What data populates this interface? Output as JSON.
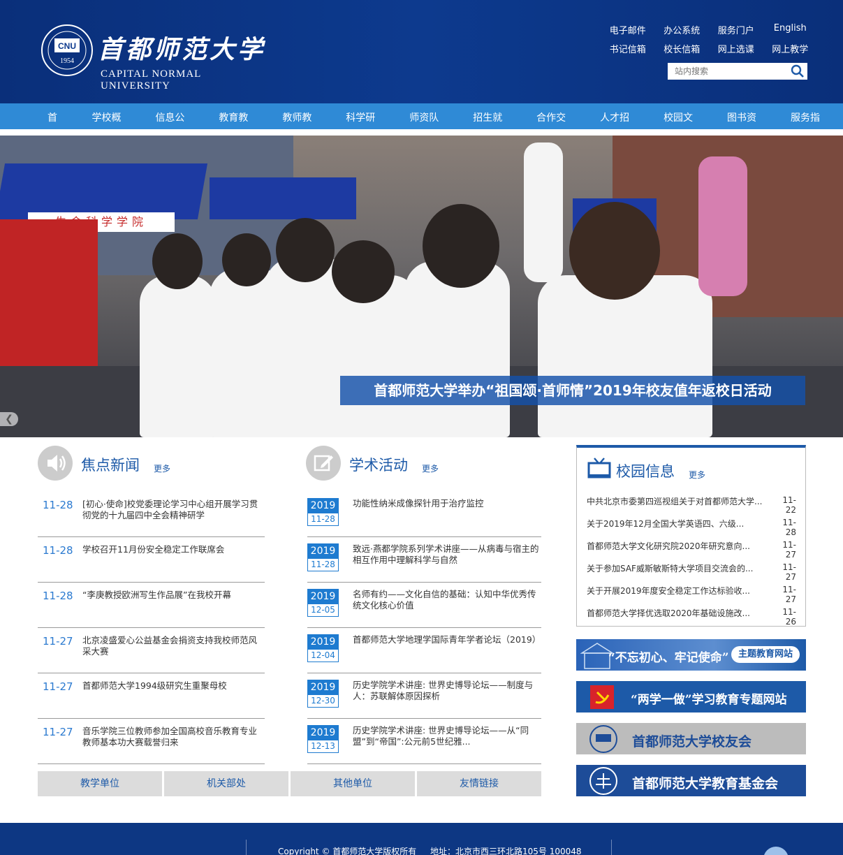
{
  "header": {
    "cn_name": "首都师范大学",
    "en_name": "CAPITAL NORMAL UNIVERSITY",
    "seal": {
      "top": "CAPITAL NORMAL UNIVERSITY",
      "abbr": "CNU",
      "year": "1954"
    },
    "top_links": [
      [
        "电子邮件",
        "办公系统",
        "服务门户",
        "English"
      ],
      [
        "书记信箱",
        "校长信箱",
        "网上选课",
        "网上教学"
      ]
    ],
    "search_placeholder": "站内搜索"
  },
  "nav": [
    "首页",
    "学校概况",
    "信息公开",
    "教育教学",
    "教师教育",
    "科学研究",
    "师资队伍",
    "招生就业",
    "合作交流",
    "人才招聘",
    "校园文化",
    "图书资料",
    "服务指南"
  ],
  "banner": {
    "caption": "首都师范大学举办“祖国颂·首师情”2019年校友值年返校日活动",
    "tent_sign": "生命科学学院"
  },
  "focus_news": {
    "title": "焦点新闻",
    "more": "更多",
    "items": [
      {
        "date": "11-28",
        "text": "[初心·使命]校党委理论学习中心组开展学习贯彻党的十九届四中全会精神研学"
      },
      {
        "date": "11-28",
        "text": "学校召开11月份安全稳定工作联席会"
      },
      {
        "date": "11-28",
        "text": "“李庚教授欧洲写生作品展”在我校开幕"
      },
      {
        "date": "11-27",
        "text": "北京凌盛爱心公益基金会捐资支持我校师范风采大赛"
      },
      {
        "date": "11-27",
        "text": "首都师范大学1994级研究生重聚母校"
      },
      {
        "date": "11-27",
        "text": "音乐学院三位教师参加全国高校音乐教育专业教师基本功大赛载誉归来"
      }
    ]
  },
  "academic": {
    "title": "学术活动",
    "more": "更多",
    "items": [
      {
        "year": "2019",
        "md": "11-28",
        "text": "功能性纳米成像探针用于治疗监控"
      },
      {
        "year": "2019",
        "md": "11-28",
        "text": "致远·燕都学院系列学术讲座——从病毒与宿主的相互作用中理解科学与自然"
      },
      {
        "year": "2019",
        "md": "12-05",
        "text": "名师有约——文化自信的基础：认知中华优秀传统文化核心价值"
      },
      {
        "year": "2019",
        "md": "12-04",
        "text": "首都师范大学地理学国际青年学者论坛（2019）"
      },
      {
        "year": "2019",
        "md": "12-30",
        "text": "历史学院学术讲座: 世界史博导论坛——制度与人：苏联解体原因探析"
      },
      {
        "year": "2019",
        "md": "12-13",
        "text": "历史学院学术讲座: 世界史博导论坛——从“同盟”到“帝国”:公元前5世纪雅..."
      }
    ]
  },
  "campus_info": {
    "title": "校园信息",
    "more": "更多",
    "items": [
      {
        "text": "中共北京市委第四巡视组关于对首都师范大学...",
        "date": "11-22"
      },
      {
        "text": "关于2019年12月全国大学英语四、六级...",
        "date": "11-28"
      },
      {
        "text": "首都师范大学文化研究院2020年研究意向...",
        "date": "11-27"
      },
      {
        "text": "关于参加SAF威斯敏斯特大学项目交流会的...",
        "date": "11-27"
      },
      {
        "text": "关于开展2019年度安全稳定工作达标验收...",
        "date": "11-27"
      },
      {
        "text": "首都师范大学择优选取2020年基础设施改...",
        "date": "11-26"
      }
    ]
  },
  "promos": [
    {
      "text": "“不忘初心、牢记使命”",
      "tag": "主题教育网站",
      "color": "#1d5aa8"
    },
    {
      "text": "“两学一做”学习教育专题网站",
      "color": "#1d5aa8"
    },
    {
      "text": "首都师范大学校友会",
      "color": "#b9b9b9"
    },
    {
      "text": "首都师范大学教育基金会",
      "color": "#1d4c98"
    }
  ],
  "tabs": [
    "教学单位",
    "机关部处",
    "其他单位",
    "友情链接"
  ],
  "footer": {
    "copyright": "Copyright © 首都师范大学版权所有",
    "address": "地址：北京市西三环北路105号 100048"
  },
  "colors": {
    "header": "#0d3a8e",
    "nav": "#2f8ad6",
    "accent": "#1d5aa8",
    "date": "#2b7ad0"
  }
}
